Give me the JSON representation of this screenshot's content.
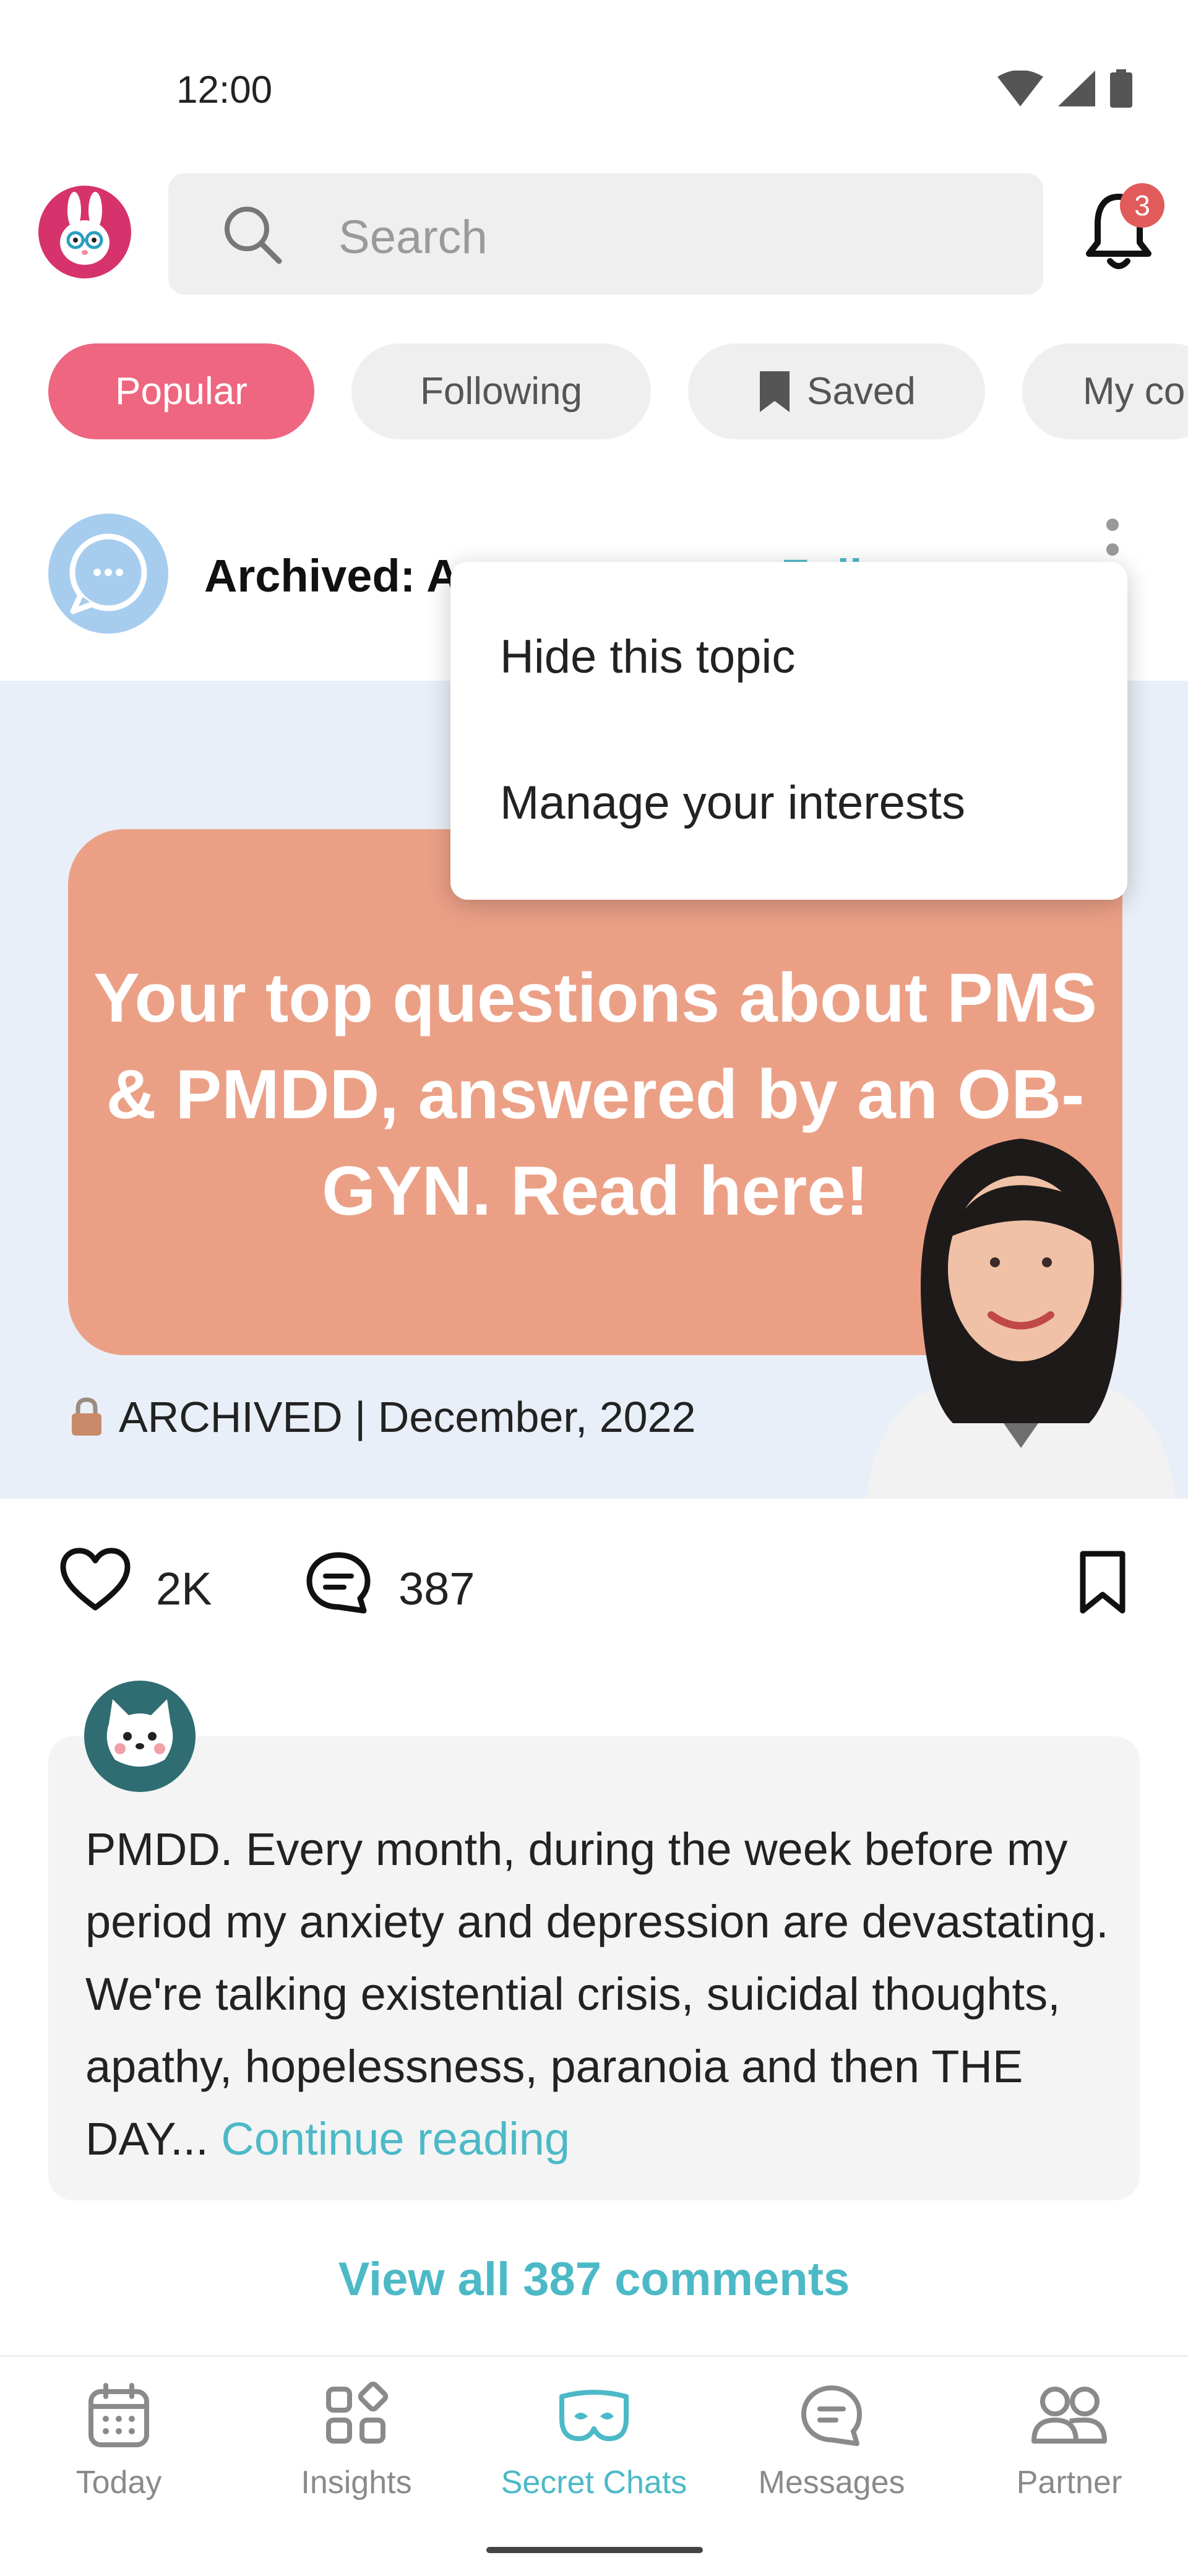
{
  "status_bar": {
    "time": "12:00"
  },
  "header": {
    "search_placeholder": "Search",
    "notification_count": "3"
  },
  "tabs": [
    {
      "label": "Popular",
      "active": true
    },
    {
      "label": "Following"
    },
    {
      "label": "Saved"
    },
    {
      "label": "My co"
    }
  ],
  "topic": {
    "title": "Archived: A",
    "follow_label": "Foll"
  },
  "menu": {
    "items": [
      "Hide this topic",
      "Manage your interests"
    ]
  },
  "banner": {
    "headline": "Your top questions about PMS & PMDD, answered by an OB-GYN. Read here!",
    "archived_text": "ARCHIVED | December, 2022"
  },
  "actions": {
    "likes": "2K",
    "comments": "387"
  },
  "comment": {
    "text": "PMDD. Every month, during the week before my period my anxiety and depression are devastating. We're talking existential crisis, suicidal thoughts, apathy, hopelessness, paranoia and then THE DAY...",
    "continue_label": "Continue reading"
  },
  "view_all_label": "View all 387 comments",
  "nav": [
    {
      "label": "Today",
      "icon": "calendar-icon"
    },
    {
      "label": "Insights",
      "icon": "grid-icon"
    },
    {
      "label": "Secret Chats",
      "icon": "mask-icon",
      "active": true
    },
    {
      "label": "Messages",
      "icon": "chat-icon"
    },
    {
      "label": "Partner",
      "icon": "people-icon"
    }
  ],
  "colors": {
    "accent_pink": "#ee6680",
    "accent_teal": "#4cb9c7",
    "banner_card": "#eba086",
    "badge_red": "#e25b5b"
  }
}
